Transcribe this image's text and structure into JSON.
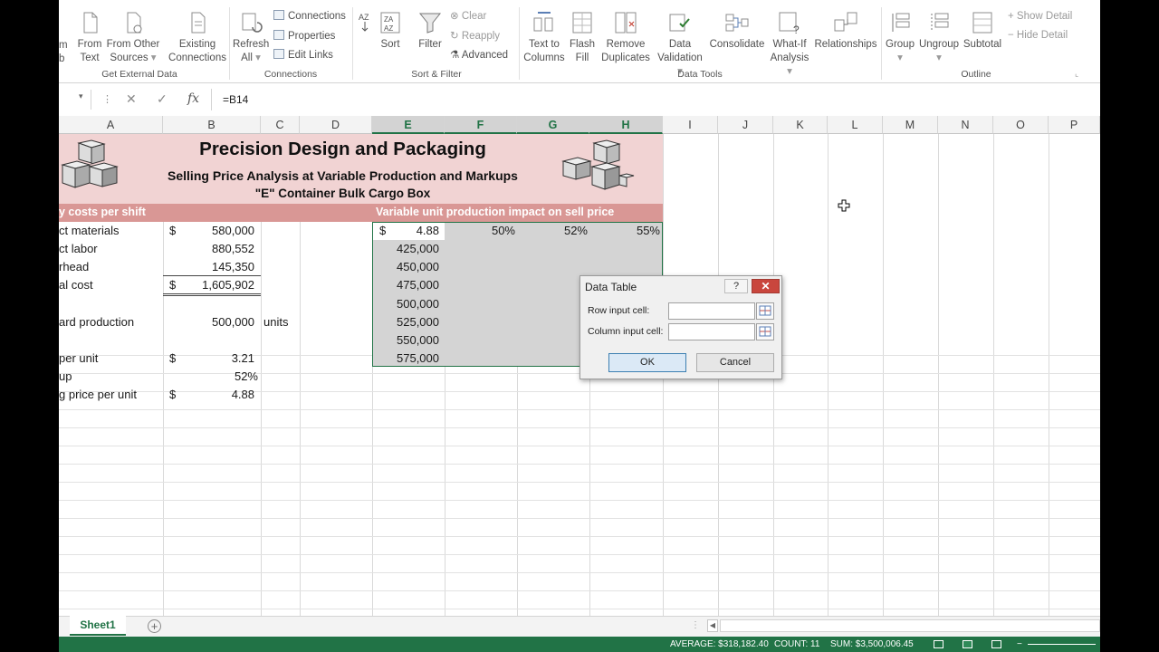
{
  "ribbon": {
    "external": {
      "partial_a": "m",
      "partial_b": "b",
      "from_text": [
        "From",
        "Text"
      ],
      "from_other": [
        "From Other",
        "Sources"
      ],
      "existing": [
        "Existing",
        "Connections"
      ],
      "label": "Get External Data"
    },
    "connections": {
      "refresh": [
        "Refresh",
        "All"
      ],
      "connections": "Connections",
      "properties": "Properties",
      "edit_links": "Edit Links",
      "label": "Connections"
    },
    "sort_filter": {
      "sort": "Sort",
      "filter": "Filter",
      "clear": "Clear",
      "reapply": "Reapply",
      "advanced": "Advanced",
      "label": "Sort & Filter"
    },
    "data_tools": {
      "text_to_columns": [
        "Text to",
        "Columns"
      ],
      "flash_fill": [
        "Flash",
        "Fill"
      ],
      "remove_dup": [
        "Remove",
        "Duplicates"
      ],
      "data_validation": [
        "Data",
        "Validation"
      ],
      "consolidate": "Consolidate",
      "what_if": [
        "What-If",
        "Analysis"
      ],
      "relationships": "Relationships",
      "label": "Data Tools"
    },
    "outline": {
      "group": "Group",
      "ungroup": "Ungroup",
      "subtotal": "Subtotal",
      "show_detail": "Show Detail",
      "hide_detail": "Hide Detail",
      "label": "Outline"
    }
  },
  "formula_bar": {
    "cancel_glyph": "✕",
    "enter_glyph": "✓",
    "fx": "fx",
    "formula": "=B14"
  },
  "columns": [
    "A",
    "B",
    "C",
    "D",
    "E",
    "F",
    "G",
    "H",
    "I",
    "J",
    "K",
    "L",
    "M",
    "N",
    "O",
    "P"
  ],
  "sheet": {
    "title": "Precision Design and Packaging",
    "subtitle": "Selling Price Analysis at Variable Production and Markups",
    "subtitle2": "\"E\" Container Bulk Cargo Box",
    "left_header": "y costs per shift",
    "right_header": "Variable unit production impact on sell price",
    "rows": [
      {
        "label": "ct materials",
        "cur": "$",
        "val": "580,000"
      },
      {
        "label": "ct labor",
        "cur": "",
        "val": "880,552"
      },
      {
        "label": "rhead",
        "cur": "",
        "val": "145,350"
      },
      {
        "label": "al cost",
        "cur": "$",
        "val": "1,605,902"
      },
      {
        "label": "ard production",
        "cur": "",
        "val": "500,000",
        "unit": "units"
      },
      {
        "label": "per unit",
        "cur": "$",
        "val": "3.21"
      },
      {
        "label": "up",
        "cur": "",
        "val": "52%"
      },
      {
        "label": "g price per unit",
        "cur": "$",
        "val": "4.88"
      }
    ],
    "table": {
      "corner_cur": "$",
      "corner_val": "4.88",
      "markups": [
        "50%",
        "52%",
        "55%"
      ],
      "production": [
        "425,000",
        "450,000",
        "475,000",
        "500,000",
        "525,000",
        "550,000",
        "575,000"
      ]
    }
  },
  "dialog": {
    "title": "Data Table",
    "help": "?",
    "close": "✕",
    "row_label": "Row input cell:",
    "col_label": "Column input cell:",
    "row_value": "",
    "col_value": "",
    "ok": "OK",
    "cancel": "Cancel"
  },
  "sheet_tab": "Sheet1",
  "add_sheet": "+",
  "status": {
    "average": "AVERAGE:  $318,182.40",
    "count": "COUNT: 11",
    "sum": "SUM:  $3,500,006.45"
  }
}
